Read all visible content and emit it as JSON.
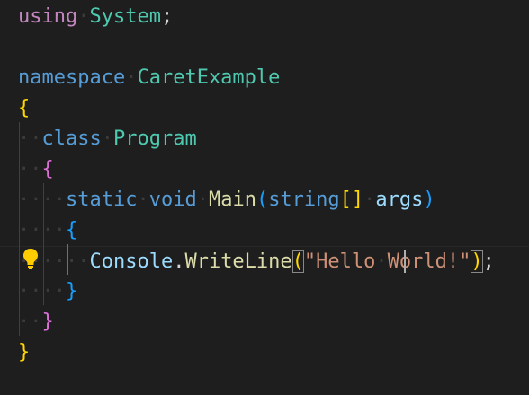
{
  "editor": {
    "lines": [
      {
        "id": "line-1",
        "tokens": [
          {
            "t": "using",
            "c": "kw-ctl"
          },
          {
            "t": "·",
            "c": "ws"
          },
          {
            "t": "System",
            "c": "type"
          },
          {
            "t": ";",
            "c": "punc"
          }
        ]
      },
      {
        "id": "line-2",
        "tokens": []
      },
      {
        "id": "line-3",
        "tokens": [
          {
            "t": "namespace",
            "c": "kw"
          },
          {
            "t": "·",
            "c": "ws"
          },
          {
            "t": "CaretExample",
            "c": "type"
          }
        ]
      },
      {
        "id": "line-4",
        "tokens": [
          {
            "t": "{",
            "c": "brace-y"
          }
        ]
      },
      {
        "id": "line-5",
        "tokens": [
          {
            "t": "··",
            "c": "ws"
          },
          {
            "t": "class",
            "c": "kw"
          },
          {
            "t": "·",
            "c": "ws"
          },
          {
            "t": "Program",
            "c": "type"
          }
        ]
      },
      {
        "id": "line-6",
        "tokens": [
          {
            "t": "··",
            "c": "ws"
          },
          {
            "t": "{",
            "c": "brace-p"
          }
        ]
      },
      {
        "id": "line-7",
        "tokens": [
          {
            "t": "····",
            "c": "ws"
          },
          {
            "t": "static",
            "c": "kw"
          },
          {
            "t": "·",
            "c": "ws"
          },
          {
            "t": "void",
            "c": "kw"
          },
          {
            "t": "·",
            "c": "ws"
          },
          {
            "t": "Main",
            "c": "fn"
          },
          {
            "t": "(",
            "c": "brace-b"
          },
          {
            "t": "string",
            "c": "kw"
          },
          {
            "t": "[]",
            "c": "brace-y"
          },
          {
            "t": "·",
            "c": "ws"
          },
          {
            "t": "args",
            "c": "param"
          },
          {
            "t": ")",
            "c": "brace-b"
          }
        ]
      },
      {
        "id": "line-8",
        "tokens": [
          {
            "t": "····",
            "c": "ws"
          },
          {
            "t": "{",
            "c": "brace-b"
          }
        ]
      },
      {
        "id": "line-9",
        "current": true,
        "tokens": [
          {
            "t": "······",
            "c": "ws"
          },
          {
            "t": "Console",
            "c": "param"
          },
          {
            "t": ".",
            "c": "punc"
          },
          {
            "t": "WriteLine",
            "c": "fn"
          },
          {
            "t": "(",
            "c": "brace-y",
            "match": true
          },
          {
            "t": "\"Hello",
            "c": "str"
          },
          {
            "t": "·",
            "c": "ws"
          },
          {
            "t": "World!\"",
            "c": "str"
          },
          {
            "t": ")",
            "c": "brace-y",
            "match": true
          },
          {
            "t": ";",
            "c": "punc"
          }
        ]
      },
      {
        "id": "line-10",
        "tokens": [
          {
            "t": "····",
            "c": "ws"
          },
          {
            "t": "}",
            "c": "brace-b"
          }
        ]
      },
      {
        "id": "line-11",
        "tokens": [
          {
            "t": "··",
            "c": "ws"
          },
          {
            "t": "}",
            "c": "brace-p"
          }
        ]
      },
      {
        "id": "line-12",
        "tokens": [
          {
            "t": "}",
            "c": "brace-y"
          }
        ]
      }
    ],
    "lightbulb_icon": "lightbulb-icon",
    "caret_line": 9,
    "colors": {
      "background": "#1e1e1e",
      "keyword": "#569cd6",
      "control_keyword": "#c586c0",
      "type": "#4ec9b0",
      "function": "#dcdcaa",
      "variable": "#9cdcfe",
      "string": "#ce9178",
      "lightbulb": "#ffcc00",
      "caret": "#aeafad"
    }
  }
}
